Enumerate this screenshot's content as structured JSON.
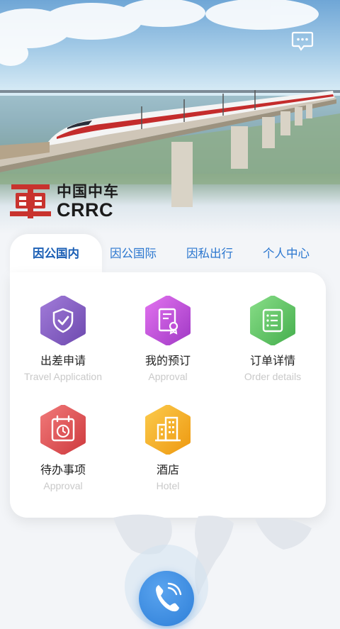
{
  "header": {
    "message_icon": "message-icon",
    "logo": {
      "cn": "中国中车",
      "en": "CRRC",
      "emblem_color": "#c8332e"
    }
  },
  "tabs": [
    {
      "label": "因公国内",
      "active": true
    },
    {
      "label": "因公国际",
      "active": false
    },
    {
      "label": "因私出行",
      "active": false
    },
    {
      "label": "个人中心",
      "active": false
    }
  ],
  "functions": [
    {
      "name": "出差申请",
      "sub": "Travel Application",
      "icon": "shield-check-icon",
      "color": "#8a63c6"
    },
    {
      "name": "我的预订",
      "sub": "Approval",
      "icon": "certificate-icon",
      "color": "#c050d8"
    },
    {
      "name": "订单详情",
      "sub": "Order details",
      "icon": "list-icon",
      "color": "#5dc262"
    },
    {
      "name": "待办事项",
      "sub": "Approval",
      "icon": "calendar-clock-icon",
      "color": "#e0504f"
    },
    {
      "name": "酒店",
      "sub": "Hotel",
      "icon": "building-icon",
      "color": "#f0a820"
    }
  ],
  "bottom": {
    "call_icon": "phone-icon",
    "accent": "#2e7fd8"
  }
}
